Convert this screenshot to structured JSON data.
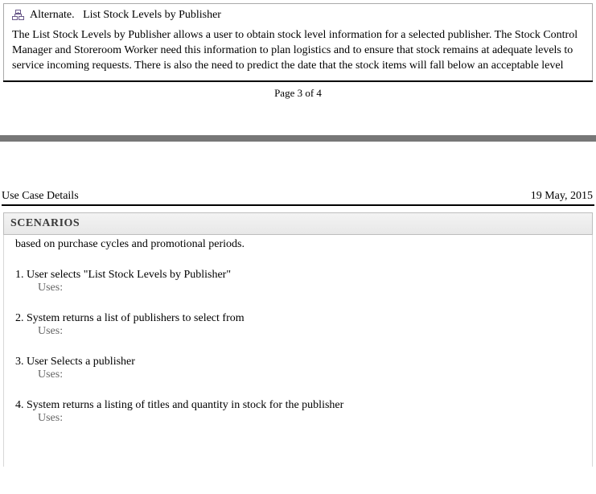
{
  "top": {
    "alternate_label": "Alternate.",
    "title": "List Stock Levels by Publisher",
    "description": "The List Stock Levels by Publisher allows a user to obtain stock level information for a selected publisher. The Stock Control Manager and Storeroom Worker need this information to plan logistics and to ensure that stock remains at adequate levels to service incoming requests. There is also the need to predict the date that the stock items will fall below an acceptable level"
  },
  "page_indicator": "Page 3 of 4",
  "header": {
    "left": "Use Case Details",
    "right": "19 May, 2015"
  },
  "scenarios_heading": "SCENARIOS",
  "continuation": "based on purchase cycles and promotional periods.",
  "uses_label": "Uses:",
  "steps": [
    {
      "num": "1.",
      "text": "User selects \"List Stock Levels by Publisher\""
    },
    {
      "num": "2.",
      "text": "System returns a list of publishers to select from"
    },
    {
      "num": "3.",
      "text": "User Selects a publisher"
    },
    {
      "num": "4.",
      "text": "System returns a listing of titles and quantity in stock for the publisher"
    }
  ]
}
